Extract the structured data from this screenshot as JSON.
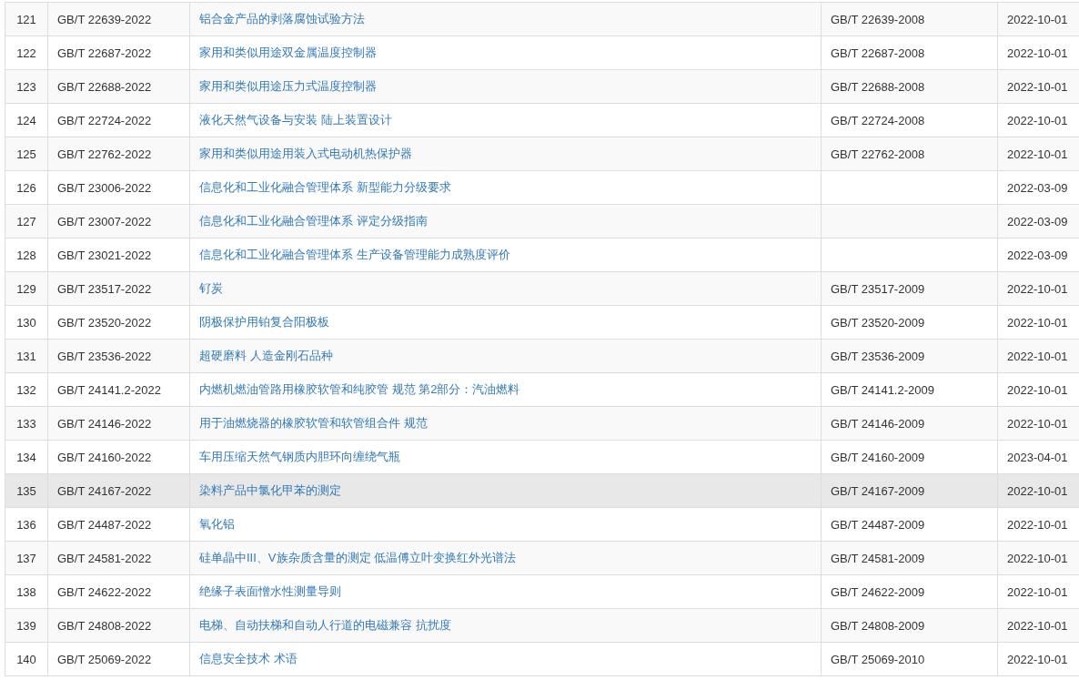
{
  "table": {
    "rows": [
      {
        "no": "121",
        "code": "GB/T 22639-2022",
        "title": "铝合金产品的剥落腐蚀试验方法",
        "replaces": "GB/T 22639-2008",
        "date": "2022-10-01",
        "selected": false
      },
      {
        "no": "122",
        "code": "GB/T 22687-2022",
        "title": "家用和类似用途双金属温度控制器",
        "replaces": "GB/T 22687-2008",
        "date": "2022-10-01",
        "selected": false
      },
      {
        "no": "123",
        "code": "GB/T 22688-2022",
        "title": "家用和类似用途压力式温度控制器",
        "replaces": "GB/T 22688-2008",
        "date": "2022-10-01",
        "selected": false
      },
      {
        "no": "124",
        "code": "GB/T 22724-2022",
        "title": "液化天然气设备与安装 陆上装置设计",
        "replaces": "GB/T 22724-2008",
        "date": "2022-10-01",
        "selected": false
      },
      {
        "no": "125",
        "code": "GB/T 22762-2022",
        "title": "家用和类似用途用装入式电动机热保护器",
        "replaces": "GB/T 22762-2008",
        "date": "2022-10-01",
        "selected": false
      },
      {
        "no": "126",
        "code": "GB/T 23006-2022",
        "title": "信息化和工业化融合管理体系 新型能力分级要求",
        "date": "2022-03-09",
        "selected": false
      },
      {
        "no": "127",
        "code": "GB/T 23007-2022",
        "title": "信息化和工业化融合管理体系 评定分级指南",
        "date": "2022-03-09",
        "selected": false
      },
      {
        "no": "128",
        "code": "GB/T 23021-2022",
        "title": "信息化和工业化融合管理体系 生产设备管理能力成熟度评价",
        "date": "2022-03-09",
        "selected": false
      },
      {
        "no": "129",
        "code": "GB/T 23517-2022",
        "title": "钌炭",
        "replaces": "GB/T 23517-2009",
        "date": "2022-10-01",
        "selected": false
      },
      {
        "no": "130",
        "code": "GB/T 23520-2022",
        "title": "阴极保护用铂复合阳极板",
        "replaces": "GB/T 23520-2009",
        "date": "2022-10-01",
        "selected": false
      },
      {
        "no": "131",
        "code": "GB/T 23536-2022",
        "title": "超硬磨料 人造金刚石品种",
        "replaces": "GB/T 23536-2009",
        "date": "2022-10-01",
        "selected": false
      },
      {
        "no": "132",
        "code": "GB/T 24141.2-2022",
        "title": "内燃机燃油管路用橡胶软管和纯胶管 规范 第2部分：汽油燃料",
        "replaces": "GB/T 24141.2-2009",
        "date": "2022-10-01",
        "selected": false
      },
      {
        "no": "133",
        "code": "GB/T 24146-2022",
        "title": "用于油燃烧器的橡胶软管和软管组合件 规范",
        "replaces": "GB/T 24146-2009",
        "date": "2022-10-01",
        "selected": false
      },
      {
        "no": "134",
        "code": "GB/T 24160-2022",
        "title": "车用压缩天然气钢质内胆环向缠绕气瓶",
        "replaces": "GB/T 24160-2009",
        "date": "2023-04-01",
        "selected": false
      },
      {
        "no": "135",
        "code": "GB/T 24167-2022",
        "title": "染料产品中氯化甲苯的测定",
        "replaces": "GB/T 24167-2009",
        "date": "2022-10-01",
        "selected": true
      },
      {
        "no": "136",
        "code": "GB/T 24487-2022",
        "title": "氧化铝",
        "replaces": "GB/T 24487-2009",
        "date": "2022-10-01",
        "selected": false
      },
      {
        "no": "137",
        "code": "GB/T 24581-2022",
        "title": "硅单晶中III、V族杂质含量的测定 低温傅立叶变换红外光谱法",
        "replaces": "GB/T 24581-2009",
        "date": "2022-10-01",
        "selected": false
      },
      {
        "no": "138",
        "code": "GB/T 24622-2022",
        "title": "绝缘子表面憎水性测量导则",
        "replaces": "GB/T 24622-2009",
        "date": "2022-10-01",
        "selected": false
      },
      {
        "no": "139",
        "code": "GB/T 24808-2022",
        "title": "电梯、自动扶梯和自动人行道的电磁兼容 抗扰度",
        "replaces": "GB/T 24808-2009",
        "date": "2022-10-01",
        "selected": false
      },
      {
        "no": "140",
        "code": "GB/T 25069-2022",
        "title": "信息安全技术 术语",
        "replaces": "GB/T 25069-2010",
        "date": "2022-10-01",
        "selected": false
      }
    ]
  }
}
